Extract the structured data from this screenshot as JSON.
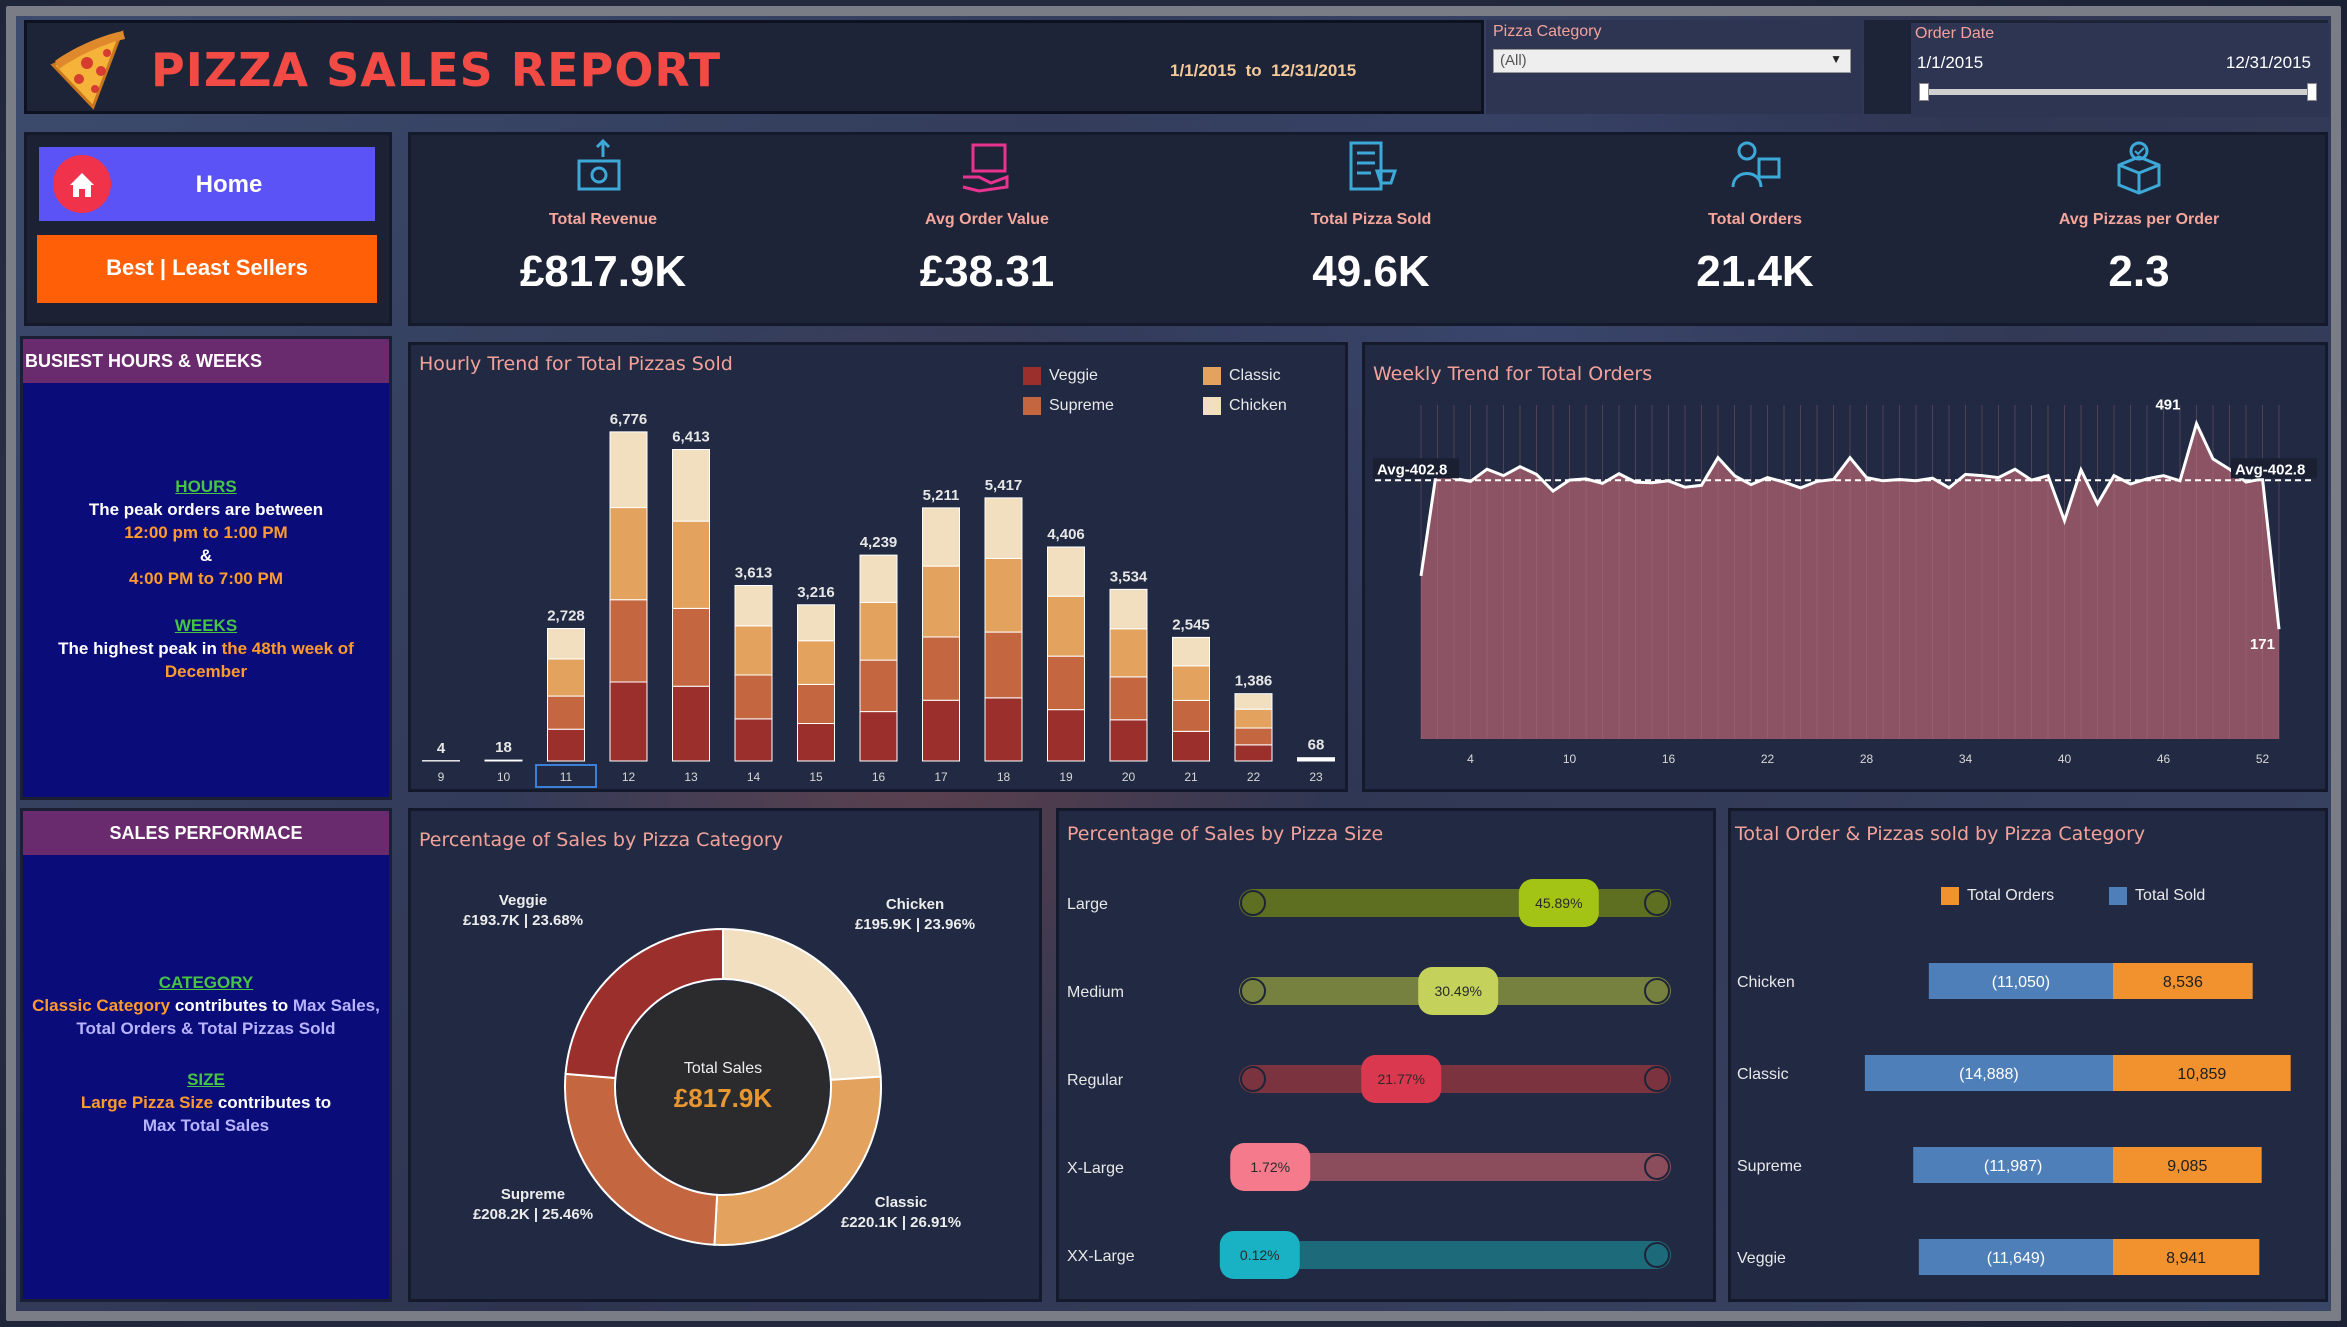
{
  "header": {
    "title": "PIZZA SALES REPORT",
    "date_range": "1/1/2015  to  12/31/2015",
    "category_filter_label": "Pizza Category",
    "category_filter_value": "(All)",
    "order_date_label": "Order Date",
    "order_date_start": "1/1/2015",
    "order_date_end": "12/31/2015"
  },
  "nav": {
    "home": "Home",
    "best_least": "Best | Least Sellers"
  },
  "kpis": [
    {
      "label": "Total Revenue",
      "value": "£817.9K"
    },
    {
      "label": "Avg Order Value",
      "value": "£38.31"
    },
    {
      "label": "Total Pizza Sold",
      "value": "49.6K"
    },
    {
      "label": "Total Orders",
      "value": "21.4K"
    },
    {
      "label": "Avg Pizzas per Order",
      "value": "2.3"
    }
  ],
  "busiest": {
    "title": "BUSIEST HOURS & WEEKS",
    "hours_head": "HOURS",
    "hours_line1": "The peak orders are between",
    "hours_line2": "12:00 pm to 1:00 PM",
    "hours_line3": "&",
    "hours_line4": "4:00 PM to 7:00 PM",
    "weeks_head": "WEEKS",
    "weeks_line1a": "The highest peak in ",
    "weeks_line1b": "the 48th week of",
    "weeks_line2": "December"
  },
  "sales_perf": {
    "title": "SALES PERFORMACE",
    "cat_head": "CATEGORY",
    "cat_a": "Classic Category",
    "cat_b": " contributes to ",
    "cat_c": "Max Sales,",
    "cat_d": "Total Orders  & Total Pizzas Sold",
    "size_head": "SIZE",
    "size_a": "Large Pizza Size",
    "size_b": "  contributes to",
    "size_c": "Max Total Sales"
  },
  "chart_data": [
    {
      "type": "bar",
      "title": "Hourly Trend for Total Pizzas Sold",
      "legend": [
        {
          "name": "Veggie",
          "color": "#9b2f2c"
        },
        {
          "name": "Classic",
          "color": "#e3a25d"
        },
        {
          "name": "Supreme",
          "color": "#c46640"
        },
        {
          "name": "Chicken",
          "color": "#f2dfc0"
        }
      ],
      "categories": [
        "9",
        "10",
        "11",
        "12",
        "13",
        "14",
        "15",
        "16",
        "17",
        "18",
        "19",
        "20",
        "21",
        "22",
        "23"
      ],
      "totals": [
        4,
        18,
        2728,
        6776,
        6413,
        3613,
        3216,
        4239,
        5211,
        5417,
        4406,
        3534,
        2545,
        1386,
        68
      ],
      "stack_order": [
        "Veggie",
        "Supreme",
        "Classic",
        "Chicken"
      ],
      "shares": [
        0.24,
        0.25,
        0.28,
        0.23
      ],
      "selected": "11"
    },
    {
      "type": "area",
      "title": "Weekly Trend for Total Orders",
      "reference_line": {
        "label": "Avg-402.8",
        "value": 402.8
      },
      "x_ticks": [
        4,
        10,
        16,
        22,
        28,
        34,
        40,
        46,
        52
      ],
      "x": [
        1,
        2,
        3,
        4,
        5,
        6,
        7,
        8,
        9,
        10,
        11,
        12,
        13,
        14,
        15,
        16,
        17,
        18,
        19,
        20,
        21,
        22,
        23,
        24,
        25,
        26,
        27,
        28,
        29,
        30,
        31,
        32,
        33,
        34,
        35,
        36,
        37,
        38,
        39,
        40,
        41,
        42,
        43,
        44,
        45,
        46,
        47,
        48,
        49,
        50,
        51,
        52,
        53
      ],
      "values": [
        254,
        427,
        406,
        401,
        420,
        410,
        424,
        412,
        386,
        403,
        405,
        398,
        413,
        400,
        399,
        402,
        392,
        395,
        438,
        410,
        396,
        407,
        400,
        391,
        401,
        404,
        438,
        407,
        402,
        404,
        402,
        406,
        391,
        412,
        410,
        407,
        420,
        403,
        410,
        340,
        419,
        366,
        410,
        397,
        405,
        410,
        402,
        491,
        436,
        420,
        400,
        405,
        171
      ],
      "annotations": [
        {
          "x": 48,
          "label": "491"
        },
        {
          "x": 53,
          "label": "171"
        }
      ],
      "ylim": [
        0,
        520
      ]
    },
    {
      "type": "pie",
      "title": "Percentage of Sales by Pizza Category",
      "center_label": "Total Sales",
      "center_value": "£817.9K",
      "slices": [
        {
          "name": "Chicken",
          "value": 23.96,
          "label": "£195.9K | 23.96%",
          "color": "#f2dfc0"
        },
        {
          "name": "Classic",
          "value": 26.91,
          "label": "£220.1K | 26.91%",
          "color": "#e3a25d"
        },
        {
          "name": "Supreme",
          "value": 25.46,
          "label": "£208.2K | 25.46%",
          "color": "#c46640"
        },
        {
          "name": "Veggie",
          "value": 23.68,
          "label": "£193.7K | 23.68%",
          "color": "#9b2f2c"
        }
      ]
    },
    {
      "type": "bar",
      "title": "Percentage of Sales by Pizza Size",
      "categories": [
        "Large",
        "Medium",
        "Regular",
        "X-Large",
        "XX-Large"
      ],
      "values": [
        45.89,
        30.49,
        21.77,
        1.72,
        0.12
      ],
      "labels": [
        "45.89%",
        "30.49%",
        "21.77%",
        "1.72%",
        "0.12%"
      ],
      "colors": [
        "#a3c414",
        "#c4d15a",
        "#d9384e",
        "#f47a8c",
        "#19b1c4"
      ],
      "track_colors": [
        "#5e6f22",
        "#77813f",
        "#7c3340",
        "#8b4c5c",
        "#1d6a7a"
      ]
    },
    {
      "type": "bar",
      "title": "Total Order & Pizzas sold by Pizza Category",
      "legend": [
        {
          "name": "Total Orders",
          "color": "#f2922f"
        },
        {
          "name": "Total Sold",
          "color": "#4f7fb8"
        }
      ],
      "categories": [
        "Chicken",
        "Classic",
        "Supreme",
        "Veggie"
      ],
      "series": [
        {
          "name": "Total Orders",
          "values": [
            11050,
            14888,
            11987,
            11649
          ],
          "labels": [
            "(11,050)",
            "(14,888)",
            "(11,987)",
            "(11,649)"
          ]
        },
        {
          "name": "Total Sold",
          "values": [
            8536,
            10859,
            9085,
            8941
          ],
          "labels": [
            "8,536",
            "10,859",
            "9,085",
            "8,941"
          ]
        }
      ]
    }
  ]
}
